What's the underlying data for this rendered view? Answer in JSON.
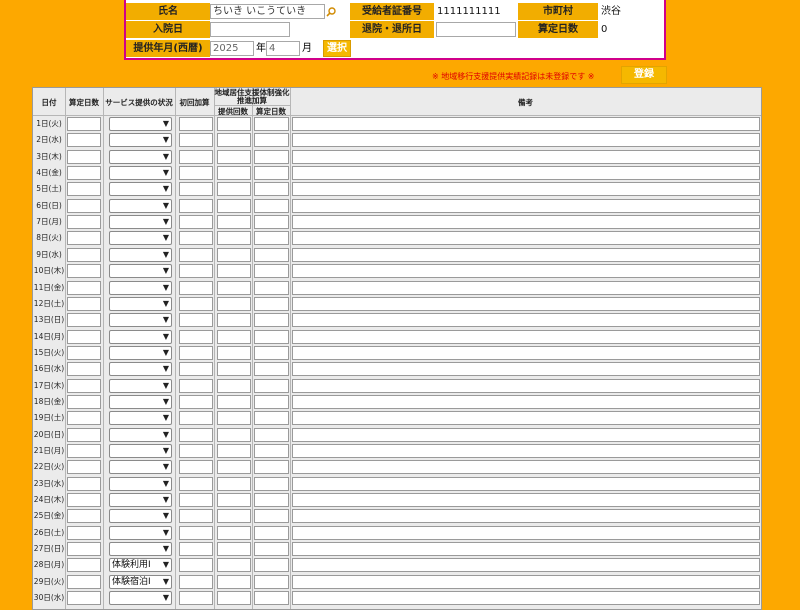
{
  "header": {
    "name_label": "氏名",
    "name_value": "ちいき いこうていき",
    "cert_label": "受給者証番号",
    "cert_value": "1111111111",
    "city_label": "市町村",
    "city_value": "渋谷",
    "admit_label": "入院日",
    "admit_value": "",
    "discharge_label": "退院・退所日",
    "discharge_value": "",
    "days_label": "算定日数",
    "days_value": "0",
    "period_label": "提供年月(西暦)",
    "year_value": "2025",
    "year_unit": "年",
    "month_value": "4",
    "month_unit": "月",
    "select_button": "選択"
  },
  "notice": "※ 地域移行支援提供実績記録は未登録です ※",
  "register_button": "登録",
  "columns": {
    "date": "日付",
    "calc_days": "算定日数",
    "service_status": "サービス提供の状況",
    "first_add": "初回加算",
    "regional_title_1": "地域居住支援体制強化",
    "regional_title_2": "推進加算",
    "provide_count": "提供回数",
    "calc_days2": "算定日数",
    "remarks": "備考"
  },
  "rows": [
    {
      "date": "1日(火)",
      "status": ""
    },
    {
      "date": "2日(水)",
      "status": ""
    },
    {
      "date": "3日(木)",
      "status": ""
    },
    {
      "date": "4日(金)",
      "status": ""
    },
    {
      "date": "5日(土)",
      "status": ""
    },
    {
      "date": "6日(日)",
      "status": ""
    },
    {
      "date": "7日(月)",
      "status": ""
    },
    {
      "date": "8日(火)",
      "status": ""
    },
    {
      "date": "9日(水)",
      "status": ""
    },
    {
      "date": "10日(木)",
      "status": ""
    },
    {
      "date": "11日(金)",
      "status": ""
    },
    {
      "date": "12日(土)",
      "status": ""
    },
    {
      "date": "13日(日)",
      "status": ""
    },
    {
      "date": "14日(月)",
      "status": ""
    },
    {
      "date": "15日(火)",
      "status": ""
    },
    {
      "date": "16日(水)",
      "status": ""
    },
    {
      "date": "17日(木)",
      "status": ""
    },
    {
      "date": "18日(金)",
      "status": ""
    },
    {
      "date": "19日(土)",
      "status": ""
    },
    {
      "date": "20日(日)",
      "status": ""
    },
    {
      "date": "21日(月)",
      "status": ""
    },
    {
      "date": "22日(火)",
      "status": ""
    },
    {
      "date": "23日(水)",
      "status": ""
    },
    {
      "date": "24日(木)",
      "status": ""
    },
    {
      "date": "25日(金)",
      "status": ""
    },
    {
      "date": "26日(土)",
      "status": ""
    },
    {
      "date": "27日(日)",
      "status": ""
    },
    {
      "date": "28日(月)",
      "status": "体験利用Ⅰ"
    },
    {
      "date": "29日(火)",
      "status": "体験宿泊Ⅰ"
    },
    {
      "date": "30日(水)",
      "status": ""
    }
  ]
}
